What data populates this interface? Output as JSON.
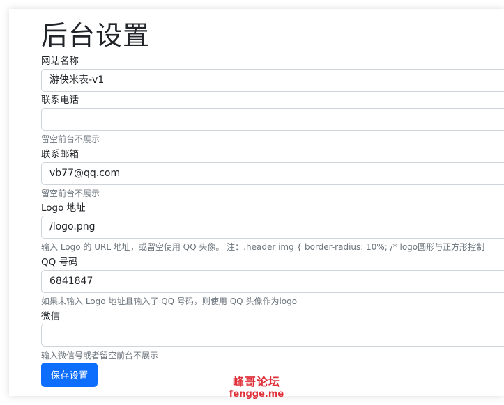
{
  "page": {
    "title": "后台设置"
  },
  "form": {
    "site_name": {
      "label": "网站名称",
      "value": "游侠米表-v1"
    },
    "phone": {
      "label": "联系电话",
      "value": "",
      "help": "留空前台不展示"
    },
    "email": {
      "label": "联系邮箱",
      "value": "vb77@qq.com",
      "help": "留空前台不展示"
    },
    "logo": {
      "label": "Logo 地址",
      "value": "/logo.png",
      "help": "输入 Logo 的 URL 地址，或留空使用 QQ 头像。 注：.header img { border-radius: 10%; /* logo圆形与正方形控制"
    },
    "qq": {
      "label": "QQ 号码",
      "value": "6841847",
      "help": "如果未输入 Logo 地址且输入了 QQ 号码，则使用 QQ 头像作为logo"
    },
    "wechat": {
      "label": "微信",
      "value": "",
      "help": "输入微信号或者留空前台不展示"
    },
    "save_label": "保存设置"
  },
  "watermark": {
    "line1": "峰哥论坛",
    "line2": "fengge.me"
  },
  "colors": {
    "primary": "#0d6efd",
    "watermark": "#e0303a",
    "help_text": "#6c757d",
    "border": "#ced4da"
  }
}
